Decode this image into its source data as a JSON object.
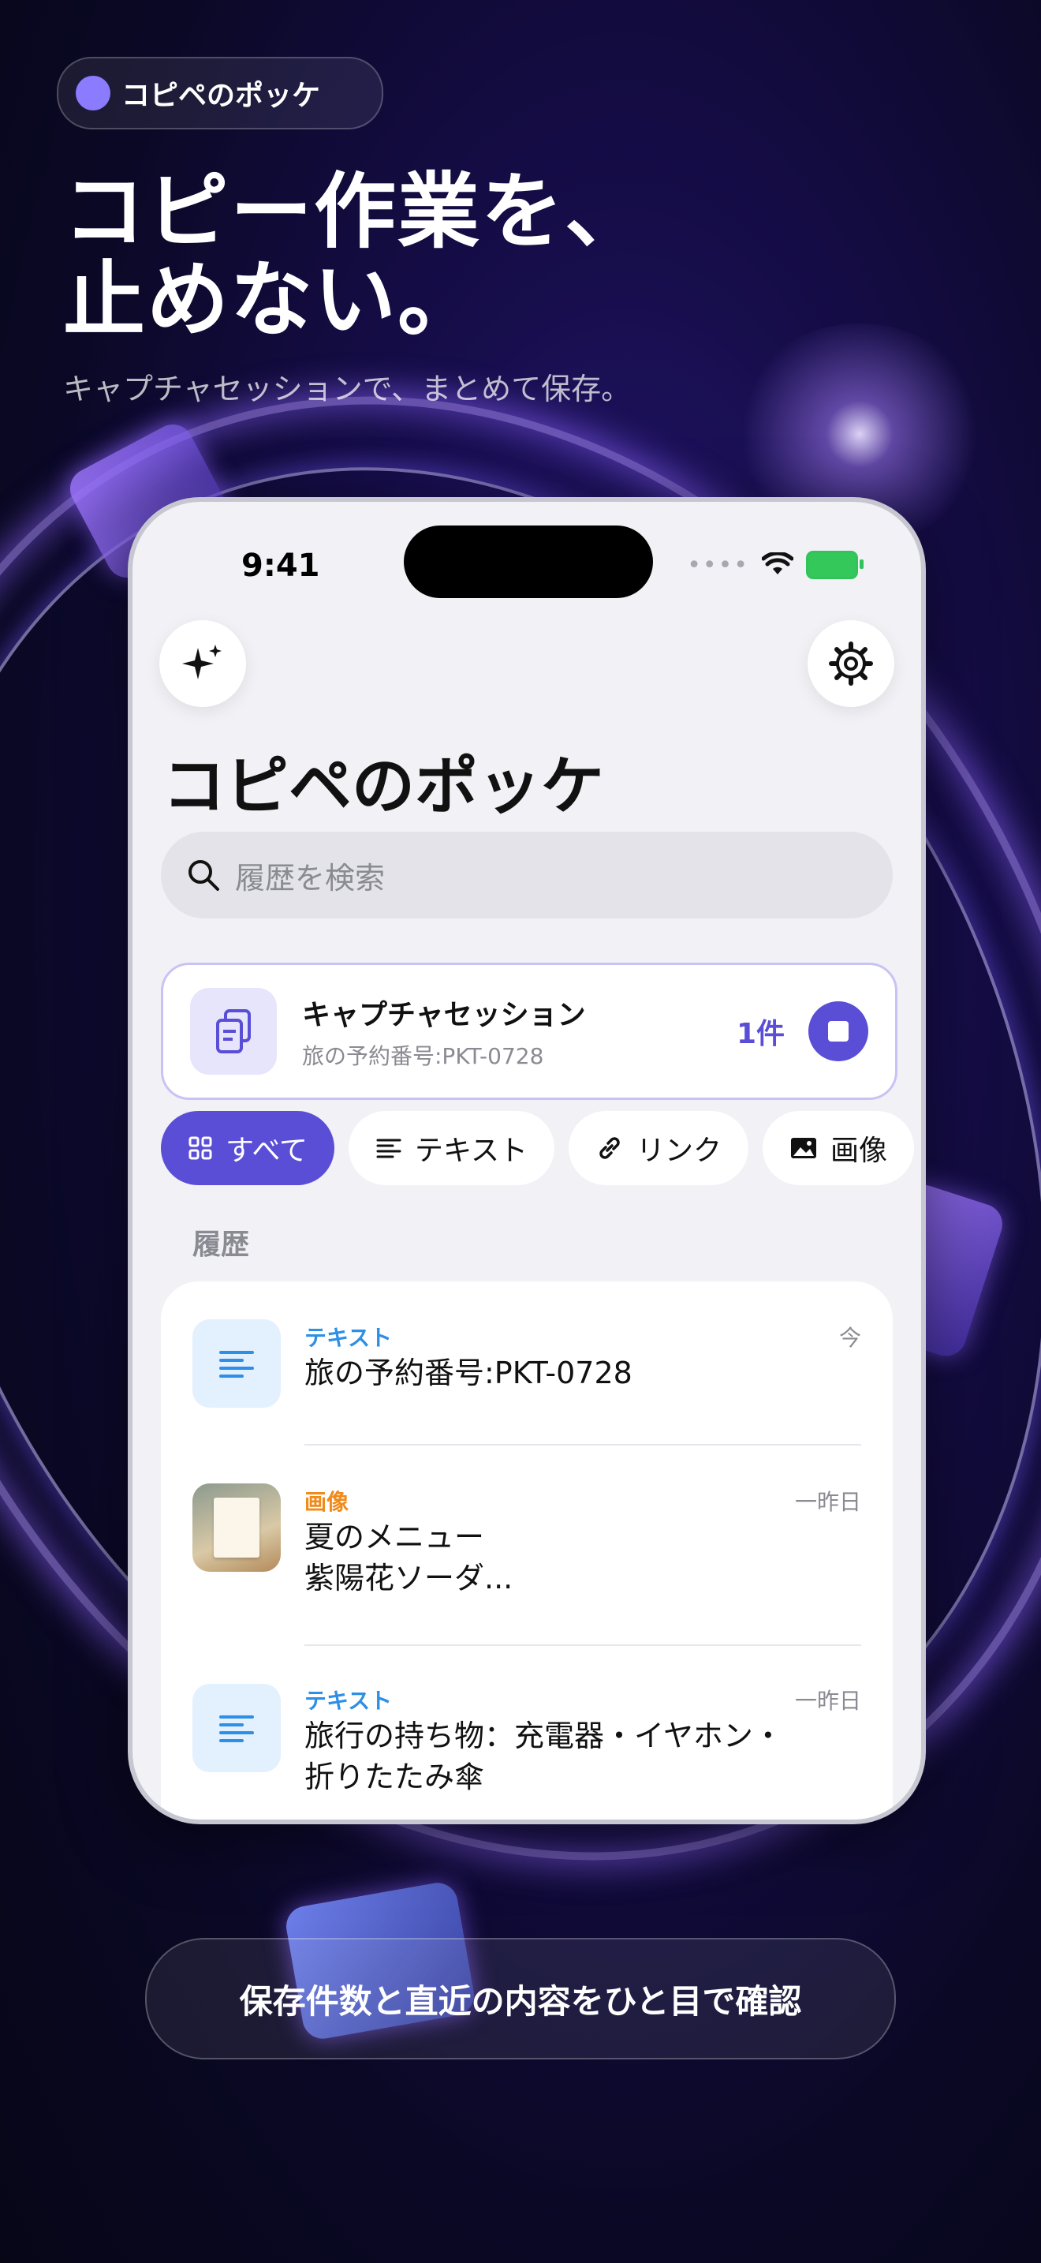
{
  "brand": {
    "name": "コピペのポッケ",
    "accent": "#8b7bff"
  },
  "headline": {
    "line1": "コピー作業を、",
    "line2": "止めない。"
  },
  "subheadline": "キャプチャセッションで、まとめて保存。",
  "phone": {
    "status_bar": {
      "time": "9:41",
      "signal_dots": "••••"
    },
    "icons": {
      "left": "sparkles-icon",
      "right": "gear-icon"
    },
    "app_title": "コピペのポッケ",
    "search": {
      "placeholder": "履歴を検索"
    },
    "capture_session": {
      "title": "キャプチャセッション",
      "subtitle": "旅の予約番号:PKT-0728",
      "count": "1件",
      "accent": "#5a4ed6"
    },
    "filters": [
      {
        "label": "すべて",
        "icon": "grid-icon",
        "active": true
      },
      {
        "label": "テキスト",
        "icon": "text-lines-icon",
        "active": false
      },
      {
        "label": "リンク",
        "icon": "link-icon",
        "active": false
      },
      {
        "label": "画像",
        "icon": "image-icon",
        "active": false
      }
    ],
    "section_label": "履歴",
    "history": [
      {
        "kind": "テキスト",
        "when": "今",
        "line1": "旅の予約番号:PKT-0728",
        "line2": ""
      },
      {
        "kind": "画像",
        "when": "一昨日",
        "line1": "夏のメニュー",
        "line2": "紫陽花ソーダ..."
      },
      {
        "kind": "テキスト",
        "when": "一昨日",
        "line1": "旅行の持ち物：充電器・イヤホン・",
        "line2": "折りたたみ傘"
      }
    ]
  },
  "caption": "保存件数と直近の内容をひと目で確認"
}
